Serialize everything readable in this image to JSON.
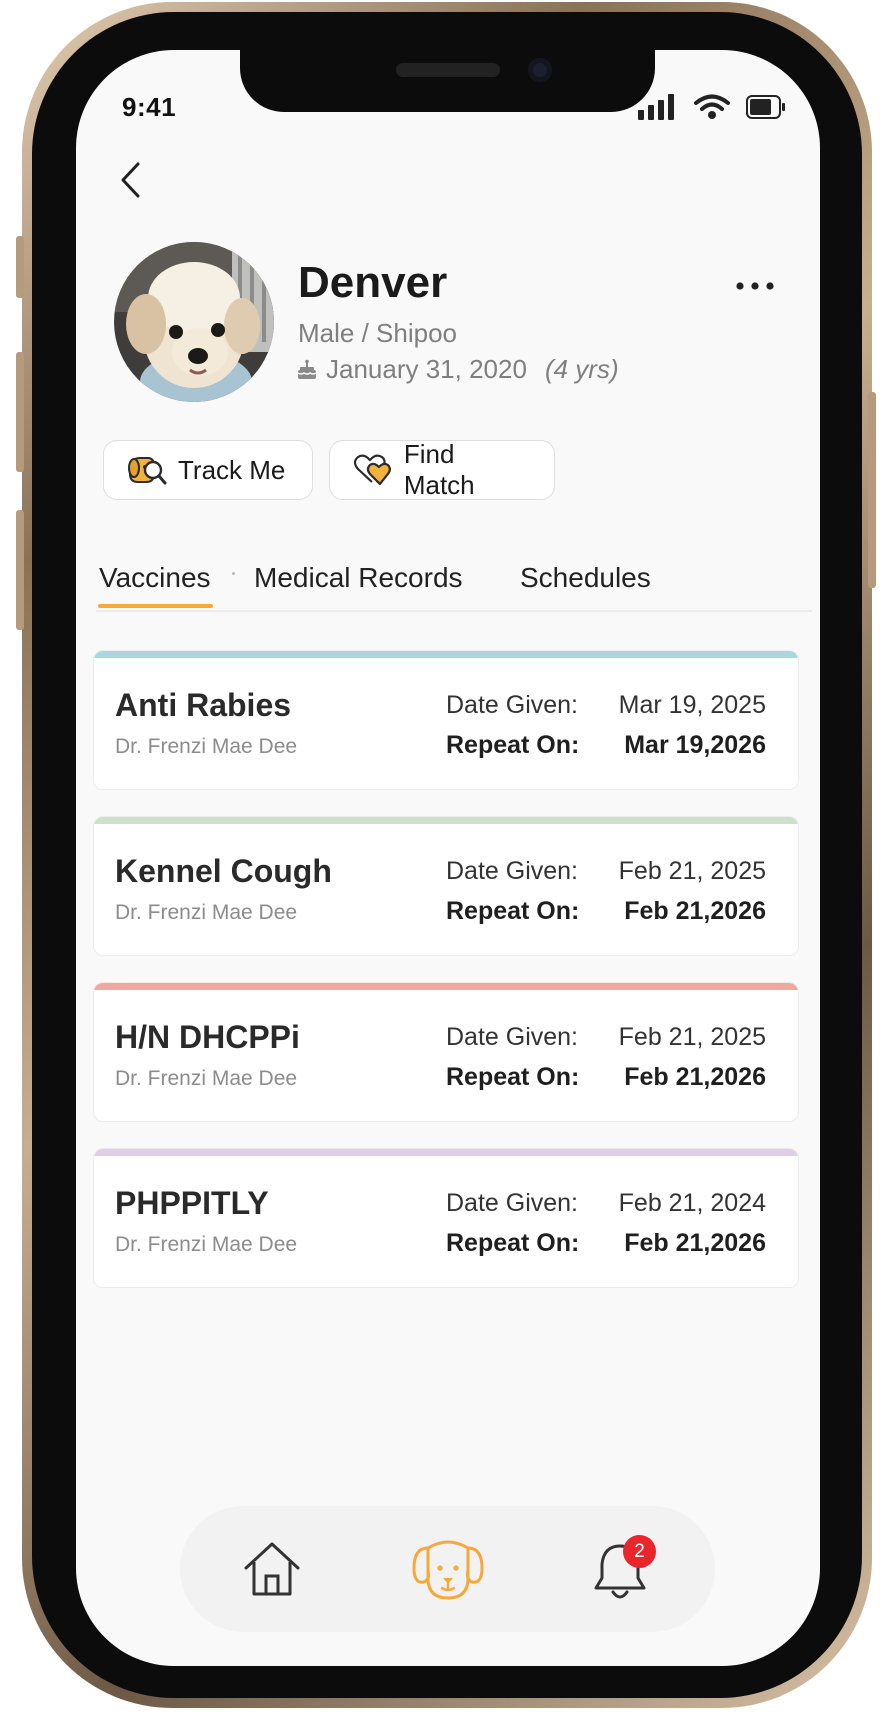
{
  "status_bar": {
    "time": "9:41"
  },
  "profile": {
    "name": "Denver",
    "sex_breed": "Male / Shipoo",
    "birthday": "January 31, 2020",
    "age": "(4 yrs)"
  },
  "actions": {
    "track_me": "Track Me",
    "find_match": "Find Match"
  },
  "tabs": [
    {
      "label": "Vaccines",
      "active": true
    },
    {
      "label": "Medical Records",
      "active": false
    },
    {
      "label": "Schedules",
      "active": false
    }
  ],
  "vaccines": [
    {
      "name": "Anti Rabies",
      "doctor": "Dr. Frenzi Mae Dee",
      "date_given_label": "Date Given:",
      "date_given": "Mar 19, 2025",
      "repeat_label": "Repeat On:",
      "repeat_on": "Mar 19,2026",
      "color": "#a8d7df"
    },
    {
      "name": "Kennel Cough",
      "doctor": "Dr. Frenzi Mae Dee",
      "date_given_label": "Date Given:",
      "date_given": "Feb 21, 2025",
      "repeat_label": "Repeat On:",
      "repeat_on": "Feb 21,2026",
      "color": "#cde0cc"
    },
    {
      "name": "H/N DHCPPi",
      "doctor": "Dr. Frenzi Mae Dee",
      "date_given_label": "Date Given:",
      "date_given": "Feb 21, 2025",
      "repeat_label": "Repeat On:",
      "repeat_on": "Feb 21,2026",
      "color": "#f3a69e"
    },
    {
      "name": "PHPPITLY",
      "doctor": "Dr. Frenzi Mae Dee",
      "date_given_label": "Date Given:",
      "date_given": "Feb 21, 2024",
      "repeat_label": "Repeat On:",
      "repeat_on": "Feb 21,2026",
      "color": "#dccfe6"
    }
  ],
  "bottom_nav": {
    "items": [
      {
        "icon": "home-icon",
        "active": false
      },
      {
        "icon": "dog-icon",
        "active": true
      },
      {
        "icon": "bell-icon",
        "active": false
      }
    ],
    "notification_count": "2"
  },
  "colors": {
    "accent": "#f5a93b",
    "badge": "#e8262c"
  }
}
